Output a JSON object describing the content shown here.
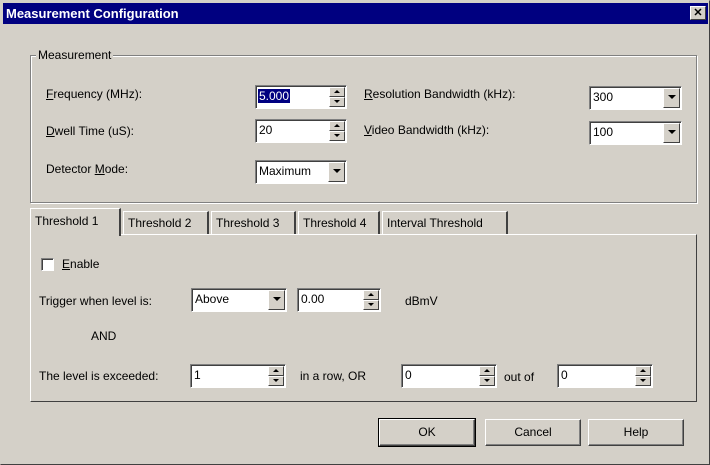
{
  "window": {
    "title": "Measurement Configuration",
    "close_glyph": "✕"
  },
  "measurement": {
    "group_label": "Measurement",
    "frequency": {
      "label_accel": "F",
      "label_rest": "requency (MHz):",
      "value": "5.000"
    },
    "dwell_time": {
      "label_accel": "D",
      "label_rest": "well Time (uS):",
      "value": "20"
    },
    "detector_mode": {
      "label_pre": "Detector ",
      "label_accel": "M",
      "label_rest": "ode:",
      "value": "Maximum"
    },
    "resolution_bw": {
      "label_accel": "R",
      "label_rest": "esolution Bandwidth (kHz):",
      "value": "300"
    },
    "video_bw": {
      "label_accel": "V",
      "label_rest": "ideo Bandwidth (kHz):",
      "value": "100"
    }
  },
  "tabs": [
    {
      "label": "Threshold 1",
      "active": true
    },
    {
      "label": "Threshold 2",
      "active": false
    },
    {
      "label": "Threshold 3",
      "active": false
    },
    {
      "label": "Threshold 4",
      "active": false
    },
    {
      "label": "Interval Threshold",
      "active": false
    }
  ],
  "threshold": {
    "enable": {
      "label_accel": "E",
      "label_rest": "nable",
      "checked": false
    },
    "trigger_label": "Trigger when level is:",
    "trigger_mode": "Above",
    "level_value": "0.00",
    "level_unit": "dBmV",
    "and_text": "AND",
    "exceeded_label": "The level is exceeded:",
    "exceeded_count": "1",
    "in_a_row_text": "in a row, OR",
    "count_value": "0",
    "out_of_text": "out of",
    "out_of_value": "0"
  },
  "buttons": {
    "ok": "OK",
    "cancel": "Cancel",
    "help": "Help"
  }
}
